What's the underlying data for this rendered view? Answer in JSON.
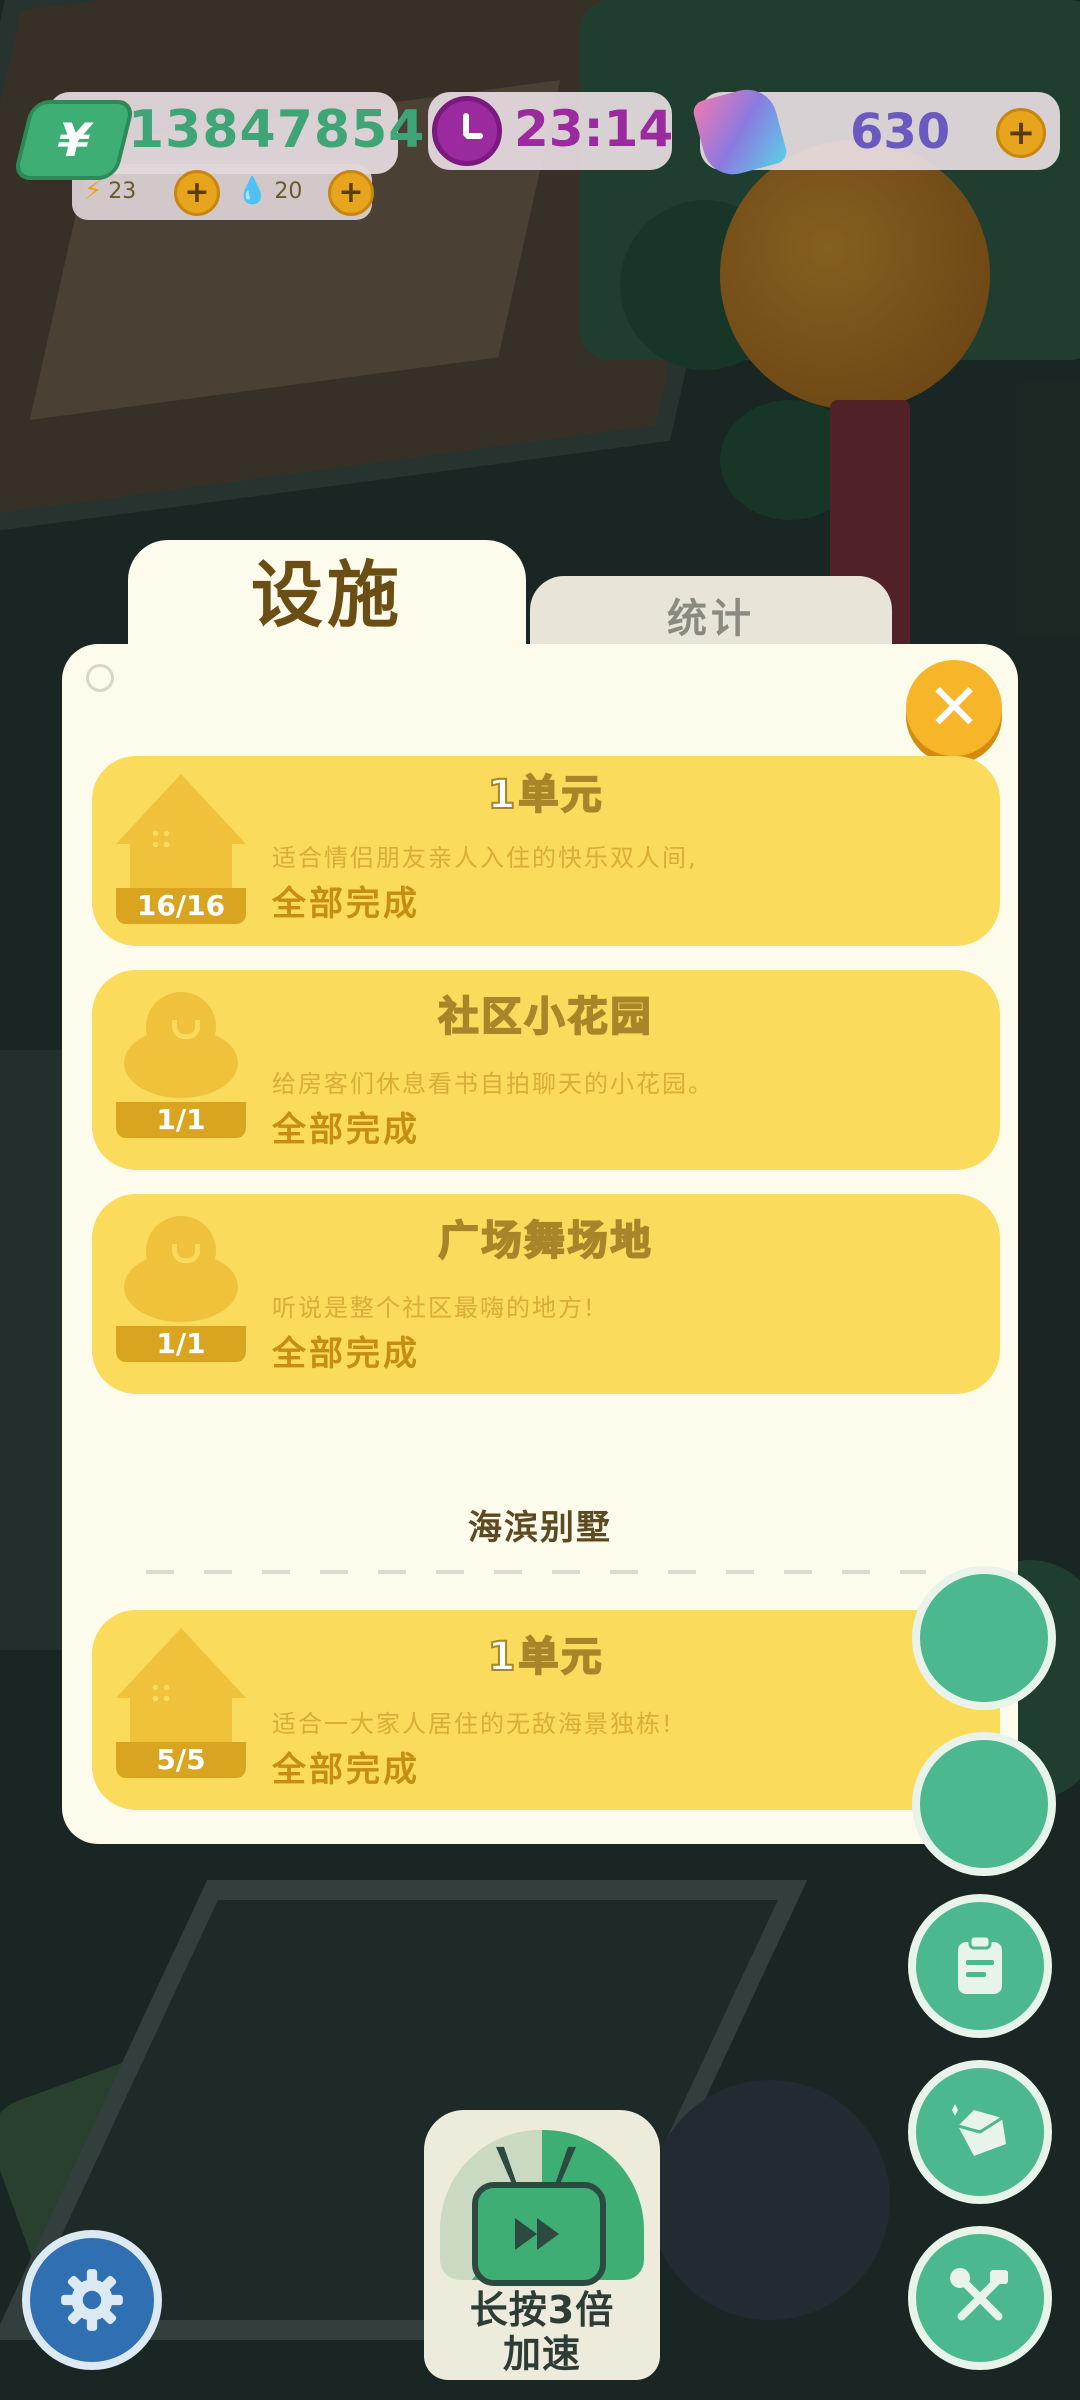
{
  "hud": {
    "money_symbol": "¥",
    "money": "13847854",
    "energy": "23",
    "water": "20",
    "time": "23:14",
    "gems": "630",
    "plus": "+"
  },
  "tabs": [
    {
      "label": "设施",
      "active": true
    },
    {
      "label": "统计",
      "active": false
    }
  ],
  "close_label": "✕",
  "groups": [
    {
      "title": "",
      "items": [
        {
          "icon": "house-icon",
          "count": "16/16",
          "name": "1单元",
          "desc": "适合情侣朋友亲人入住的快乐双人间,",
          "status": "全部完成"
        },
        {
          "icon": "tree-icon",
          "count": "1/1",
          "name": "社区小花园",
          "desc": "给房客们休息看书自拍聊天的小花园。",
          "status": "全部完成"
        },
        {
          "icon": "tree-icon",
          "count": "1/1",
          "name": "广场舞场地",
          "desc": "听说是整个社区最嗨的地方!",
          "status": "全部完成"
        }
      ]
    },
    {
      "title": "海滨别墅",
      "items": [
        {
          "icon": "house-icon",
          "count": "5/5",
          "name": "1单元",
          "desc": "适合一大家人居住的无敌海景独栋!",
          "status": "全部完成"
        }
      ]
    }
  ],
  "speed_button": {
    "line1": "长按3倍",
    "line2": "加速"
  },
  "colors": {
    "panel": "#fdfbec",
    "card": "#fadb5c",
    "accent": "#f7b52a",
    "money": "#3fa576",
    "clock": "#9a2a9e",
    "gem": "#6a5abf",
    "side_button": "#4cb890"
  }
}
